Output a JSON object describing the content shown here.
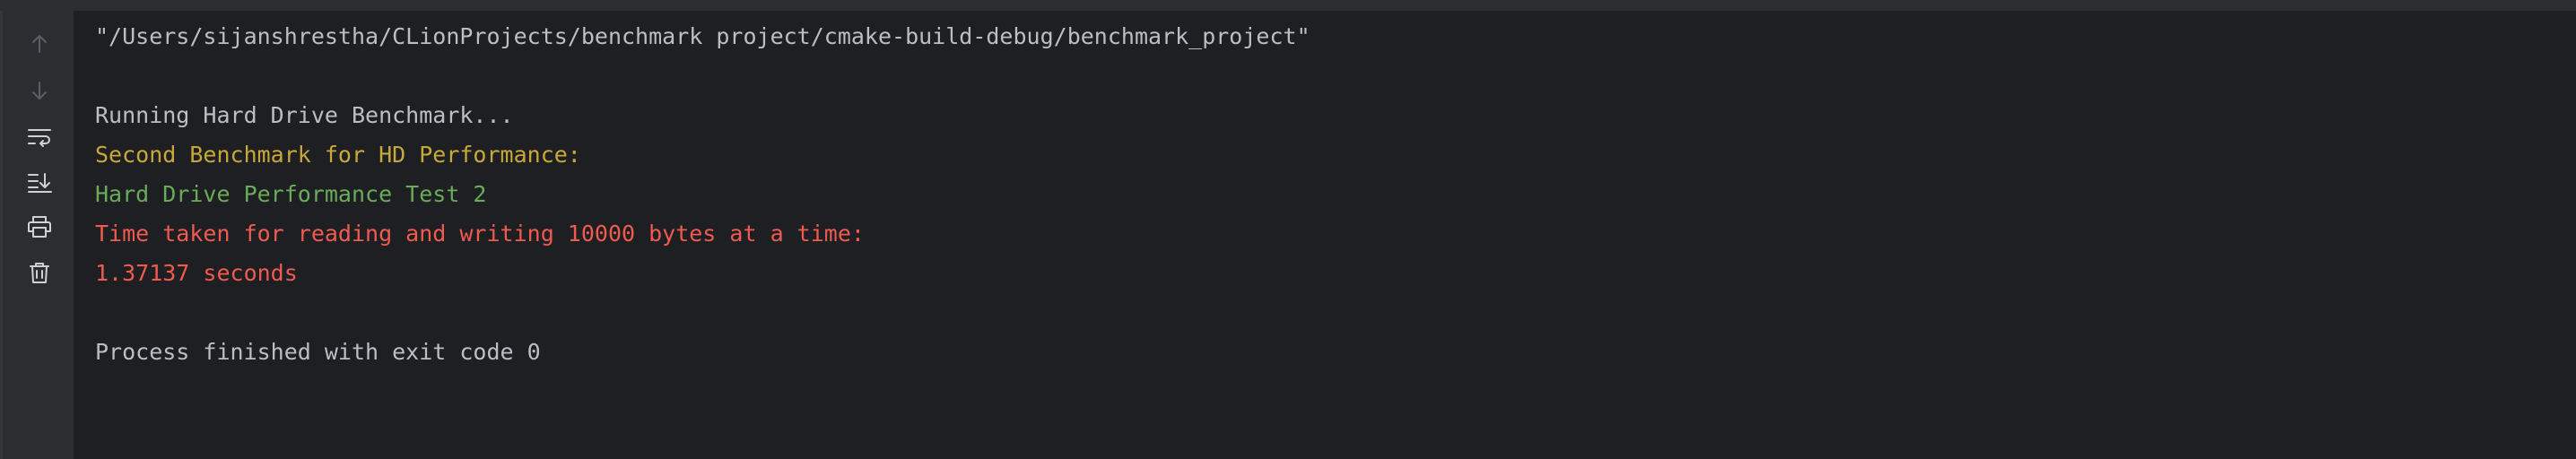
{
  "toolbar": {
    "buttons": [
      {
        "name": "up-arrow-icon",
        "enabled": false
      },
      {
        "name": "down-arrow-icon",
        "enabled": false
      },
      {
        "name": "soft-wrap-icon",
        "enabled": true
      },
      {
        "name": "scroll-to-end-icon",
        "enabled": true
      },
      {
        "name": "print-icon",
        "enabled": true
      },
      {
        "name": "trash-icon",
        "enabled": true
      }
    ]
  },
  "console": {
    "lines": [
      {
        "text": "\"/Users/sijanshrestha/CLionProjects/benchmark project/cmake-build-debug/benchmark_project\"",
        "color": "#bcbec4"
      },
      {
        "text": "Running Hard Drive Benchmark...",
        "color": "#bcbec4"
      },
      {
        "text": "Second Benchmark for HD Performance:",
        "color": "#c9a83a"
      },
      {
        "text": "Hard Drive Performance Test 2",
        "color": "#6aab5a"
      },
      {
        "text": "Time taken for reading and writing 10000 bytes at a time:",
        "color": "#f05a4f"
      },
      {
        "text": "1.37137 seconds",
        "color": "#f05a4f"
      },
      {
        "text": "Process finished with exit code 0",
        "color": "#bcbec4"
      }
    ]
  },
  "colors": {
    "background": "#1e1f22",
    "gutter": "#2b2d30",
    "icon_enabled": "#ced0d6",
    "icon_disabled": "#5a5d63"
  }
}
